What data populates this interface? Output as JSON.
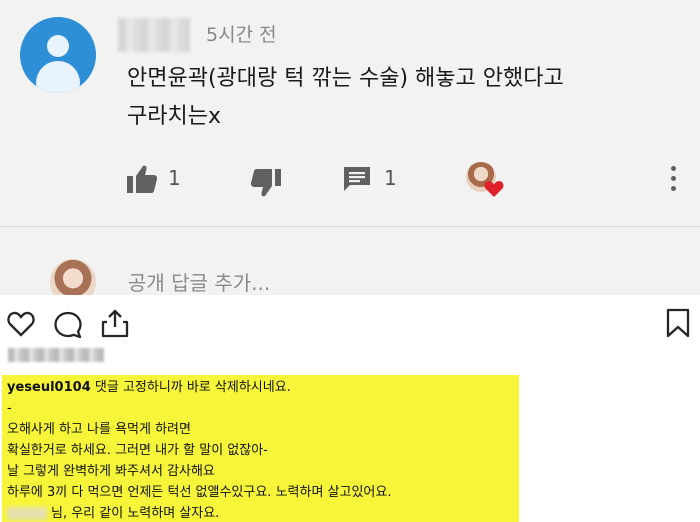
{
  "youtube": {
    "time": "5시간 전",
    "comment_lines": [
      "안면윤곽(광대랑 턱 깎는 수술) 해놓고 안했다고",
      "구라치는x"
    ],
    "like_count": "1",
    "reply_count": "1",
    "reply_placeholder": "공개 답글 추가...",
    "colors": {
      "background": "#f2f2f2",
      "avatar": "#2e8fd6",
      "creator_heart": "#e0202a"
    }
  },
  "instagram": {
    "caption": {
      "username": "yeseul0104",
      "first_line": " 댓글 고정하니까 바로 삭제하시네요.",
      "separator": "-",
      "lines": [
        "오해사게 하고 나를 욕먹게 하려면",
        "확실한거로 하세요. 그러면 내가 할 말이 없잖아-",
        "날 그렇게 완벽하게 봐주셔서 감사해요",
        "하루에 3끼 다 먹으면 언제든 턱선 없앨수있구요. 노력하며 살고있어요."
      ],
      "last_line": "님, 우리 같이 노력하며 살자요."
    },
    "colors": {
      "highlight": "#f6f53a"
    }
  }
}
